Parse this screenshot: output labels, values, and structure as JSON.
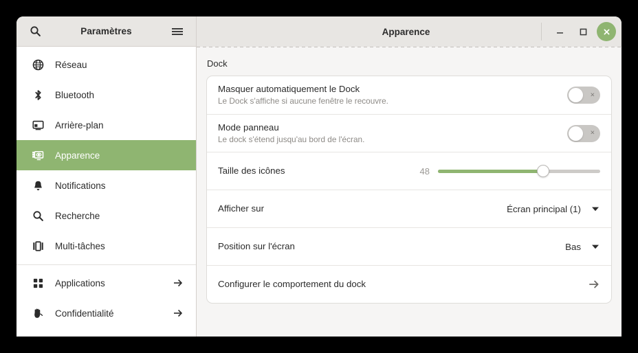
{
  "window": {
    "sidebar_title": "Paramètres",
    "content_title": "Apparence",
    "search_icon": "search-icon",
    "menu_icon": "hamburger-menu-icon",
    "minimize_label": "—",
    "maximize_label": "□",
    "close_label": "×",
    "accent_green": "#8fb571",
    "header_bg": "#e8e6e3",
    "content_bg": "#f6f5f4"
  },
  "sidebar": {
    "items": [
      {
        "label": "Réseau",
        "icon": "globe-icon",
        "selected": false,
        "arrow": false
      },
      {
        "label": "Bluetooth",
        "icon": "bluetooth-icon",
        "selected": false,
        "arrow": false
      },
      {
        "label": "Arrière-plan",
        "icon": "wallpaper-icon",
        "selected": false,
        "arrow": false
      },
      {
        "label": "Apparence",
        "icon": "appearance-icon",
        "selected": true,
        "arrow": false
      },
      {
        "label": "Notifications",
        "icon": "bell-icon",
        "selected": false,
        "arrow": false
      },
      {
        "label": "Recherche",
        "icon": "search-icon",
        "selected": false,
        "arrow": false
      },
      {
        "label": "Multi-tâches",
        "icon": "multitasking-icon",
        "selected": false,
        "arrow": false
      },
      {
        "label": "Applications",
        "icon": "grid-apps-icon",
        "selected": false,
        "arrow": true
      },
      {
        "label": "Confidentialité",
        "icon": "hand-privacy-icon",
        "selected": false,
        "arrow": true
      }
    ]
  },
  "main": {
    "section_title": "Dock",
    "rows": {
      "autohide": {
        "title": "Masquer automatiquement le Dock",
        "subtitle": "Le Dock s'affiche si aucune fenêtre le recouvre.",
        "toggle_state": "off",
        "toggle_mark": "×"
      },
      "panel_mode": {
        "title": "Mode panneau",
        "subtitle": "Le dock s'étend jusqu'au bord de l'écran.",
        "toggle_state": "off",
        "toggle_mark": "×"
      },
      "icon_size": {
        "title": "Taille des icônes",
        "value": "48",
        "percent": 65,
        "min": 16,
        "max": 64
      },
      "show_on": {
        "title": "Afficher sur",
        "value": "Écran principal (1)",
        "arrow_icon": "chevron-down-icon"
      },
      "screen_position": {
        "title": "Position sur l'écran",
        "value": "Bas",
        "arrow_icon": "chevron-down-icon"
      },
      "configure": {
        "title": "Configurer le comportement du dock",
        "arrow_icon": "arrow-right-icon"
      }
    }
  }
}
